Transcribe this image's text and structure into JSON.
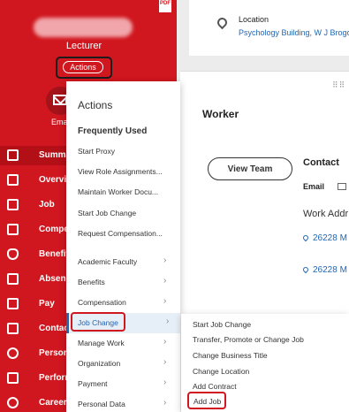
{
  "profile": {
    "role": "Lecturer",
    "actions_label": "Actions",
    "email_short_label": "Ema",
    "pdf_label": "PDF"
  },
  "sidebar": {
    "items": [
      {
        "label": "Summa",
        "icon": "grid-icon"
      },
      {
        "label": "Overvie",
        "icon": "document-icon"
      },
      {
        "label": "Job",
        "icon": "briefcase-icon"
      },
      {
        "label": "Compe",
        "icon": "chart-icon"
      },
      {
        "label": "Benefit",
        "icon": "shield-icon"
      },
      {
        "label": "Absenc",
        "icon": "clipboard-icon"
      },
      {
        "label": "Pay",
        "icon": "wallet-icon"
      },
      {
        "label": "Contac",
        "icon": "contact-card-icon"
      },
      {
        "label": "Person",
        "icon": "person-icon"
      },
      {
        "label": "Perforr",
        "icon": "clipboard-check-icon"
      },
      {
        "label": "Career",
        "icon": "globe-icon"
      }
    ]
  },
  "location": {
    "title": "Location",
    "value": "Psychology Building, W J Brogo"
  },
  "worker": {
    "title": "Worker",
    "view_team_label": "View Team",
    "contact_title": "Contact",
    "email_label": "Email",
    "work_address_label": "Work Addr",
    "address_lines": [
      "26228 M",
      "26228 M"
    ]
  },
  "actions_menu": {
    "title": "Actions",
    "section_title": "Frequently Used",
    "frequent": [
      "Start Proxy",
      "View Role Assignments...",
      "Maintain Worker Docu...",
      "Start Job Change",
      "Request Compensation..."
    ],
    "categories": [
      "Academic Faculty",
      "Benefits",
      "Compensation",
      "Job Change",
      "Manage Work",
      "Organization",
      "Payment",
      "Personal Data"
    ],
    "selected": "Job Change"
  },
  "submenu": {
    "items": [
      "Start Job Change",
      "Transfer, Promote or Change Job",
      "Change Business Title",
      "Change Location",
      "Add Contract",
      "Add Job"
    ]
  },
  "colors": {
    "brand_red": "#d0161e",
    "link_blue": "#2266b3",
    "highlight_outline": "#d0161e"
  }
}
